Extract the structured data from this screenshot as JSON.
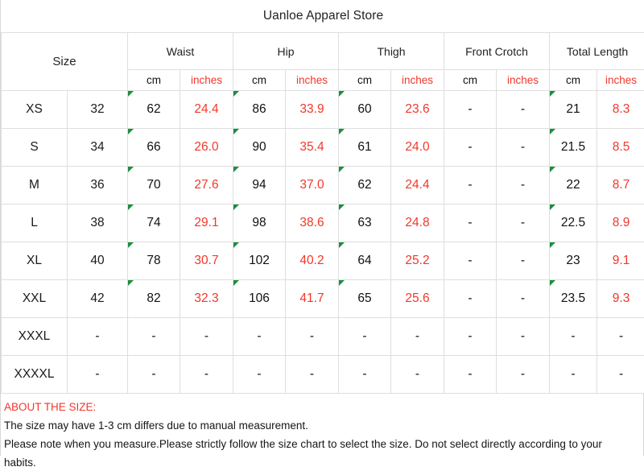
{
  "title": "Uanloe Apparel Store",
  "colors": {
    "inches_red": "#f2372a",
    "cm_black": "#111111",
    "grid_gray": "#dedede",
    "error_flag_green": "#1a8f3c"
  },
  "header": {
    "size_label": "Size",
    "groups": [
      {
        "label": "Waist"
      },
      {
        "label": "Hip"
      },
      {
        "label": "Thigh"
      },
      {
        "label": "Front Crotch"
      },
      {
        "label": "Total Length"
      }
    ],
    "units": [
      "cm",
      "inches",
      "cm",
      "inches",
      "cm",
      "inches",
      "cm",
      "inches",
      "cm",
      "inches"
    ]
  },
  "rows": [
    {
      "size": "XS",
      "num": "32",
      "waist_cm": "62",
      "waist_in": "24.4",
      "hip_cm": "86",
      "hip_in": "33.9",
      "thigh_cm": "60",
      "thigh_in": "23.6",
      "crotch_cm": "-",
      "crotch_in": "-",
      "length_cm": "21",
      "length_in": "8.3",
      "flags": true
    },
    {
      "size": "S",
      "num": "34",
      "waist_cm": "66",
      "waist_in": "26.0",
      "hip_cm": "90",
      "hip_in": "35.4",
      "thigh_cm": "61",
      "thigh_in": "24.0",
      "crotch_cm": "-",
      "crotch_in": "-",
      "length_cm": "21.5",
      "length_in": "8.5",
      "flags": true
    },
    {
      "size": "M",
      "num": "36",
      "waist_cm": "70",
      "waist_in": "27.6",
      "hip_cm": "94",
      "hip_in": "37.0",
      "thigh_cm": "62",
      "thigh_in": "24.4",
      "crotch_cm": "-",
      "crotch_in": "-",
      "length_cm": "22",
      "length_in": "8.7",
      "flags": true
    },
    {
      "size": "L",
      "num": "38",
      "waist_cm": "74",
      "waist_in": "29.1",
      "hip_cm": "98",
      "hip_in": "38.6",
      "thigh_cm": "63",
      "thigh_in": "24.8",
      "crotch_cm": "-",
      "crotch_in": "-",
      "length_cm": "22.5",
      "length_in": "8.9",
      "flags": true
    },
    {
      "size": "XL",
      "num": "40",
      "waist_cm": "78",
      "waist_in": "30.7",
      "hip_cm": "102",
      "hip_in": "40.2",
      "thigh_cm": "64",
      "thigh_in": "25.2",
      "crotch_cm": "-",
      "crotch_in": "-",
      "length_cm": "23",
      "length_in": "9.1",
      "flags": true
    },
    {
      "size": "XXL",
      "num": "42",
      "waist_cm": "82",
      "waist_in": "32.3",
      "hip_cm": "106",
      "hip_in": "41.7",
      "thigh_cm": "65",
      "thigh_in": "25.6",
      "crotch_cm": "-",
      "crotch_in": "-",
      "length_cm": "23.5",
      "length_in": "9.3",
      "flags": true
    },
    {
      "size": "XXXL",
      "num": "-",
      "waist_cm": "-",
      "waist_in": "-",
      "hip_cm": "-",
      "hip_in": "-",
      "thigh_cm": "-",
      "thigh_in": "-",
      "crotch_cm": "-",
      "crotch_in": "-",
      "length_cm": "-",
      "length_in": "-",
      "flags": false
    },
    {
      "size": "XXXXL",
      "num": "-",
      "waist_cm": "-",
      "waist_in": "-",
      "hip_cm": "-",
      "hip_in": "-",
      "thigh_cm": "-",
      "thigh_in": "-",
      "crotch_cm": "-",
      "crotch_in": "-",
      "length_cm": "-",
      "length_in": "-",
      "flags": false
    }
  ],
  "footer": {
    "heading": "ABOUT THE SIZE:",
    "line1": "The size may have 1-3 cm differs due to manual measurement.",
    "line2": "Please note when you measure.Please strictly follow the size chart  to select the size. Do not select directly according to your",
    "line3": "habits."
  }
}
